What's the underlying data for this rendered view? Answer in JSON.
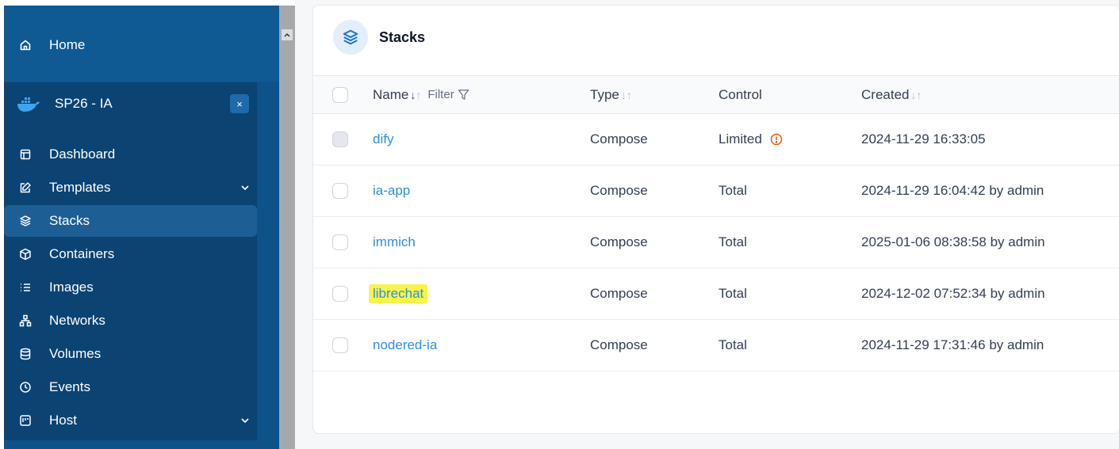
{
  "sidebar": {
    "home_label": "Home",
    "environment": {
      "name": "SP26 - IA",
      "close_label": "×"
    },
    "items": [
      {
        "label": "Dashboard",
        "icon": "dashboard-icon"
      },
      {
        "label": "Templates",
        "icon": "templates-icon",
        "has_submenu": true
      },
      {
        "label": "Stacks",
        "icon": "stacks-icon",
        "active": true
      },
      {
        "label": "Containers",
        "icon": "containers-icon"
      },
      {
        "label": "Images",
        "icon": "images-icon"
      },
      {
        "label": "Networks",
        "icon": "networks-icon"
      },
      {
        "label": "Volumes",
        "icon": "volumes-icon"
      },
      {
        "label": "Events",
        "icon": "events-icon"
      },
      {
        "label": "Host",
        "icon": "host-icon",
        "has_submenu": true
      }
    ]
  },
  "page": {
    "title": "Stacks"
  },
  "table": {
    "headers": {
      "name": "Name",
      "filter": "Filter",
      "type": "Type",
      "control": "Control",
      "created": "Created"
    },
    "rows": [
      {
        "name": "dify",
        "type": "Compose",
        "control": "Limited",
        "created": "2024-11-29 16:33:05",
        "disabled": true,
        "warning": true
      },
      {
        "name": "ia-app",
        "type": "Compose",
        "control": "Total",
        "created": "2024-11-29 16:04:42 by admin"
      },
      {
        "name": "immich",
        "type": "Compose",
        "control": "Total",
        "created": "2025-01-06 08:38:58 by admin"
      },
      {
        "name": "librechat",
        "type": "Compose",
        "control": "Total",
        "created": "2024-12-02 07:52:34 by admin",
        "highlighted": true
      },
      {
        "name": "nodered-ia",
        "type": "Compose",
        "control": "Total",
        "created": "2024-11-29 17:31:46 by admin"
      }
    ]
  },
  "colors": {
    "sidebar_bg": "#0d5289",
    "sidebar_panel": "#0b4373",
    "active_item": "#1d5f95",
    "link": "#2e90d9",
    "highlight": "#f7f44a",
    "warning": "#e8590c"
  }
}
